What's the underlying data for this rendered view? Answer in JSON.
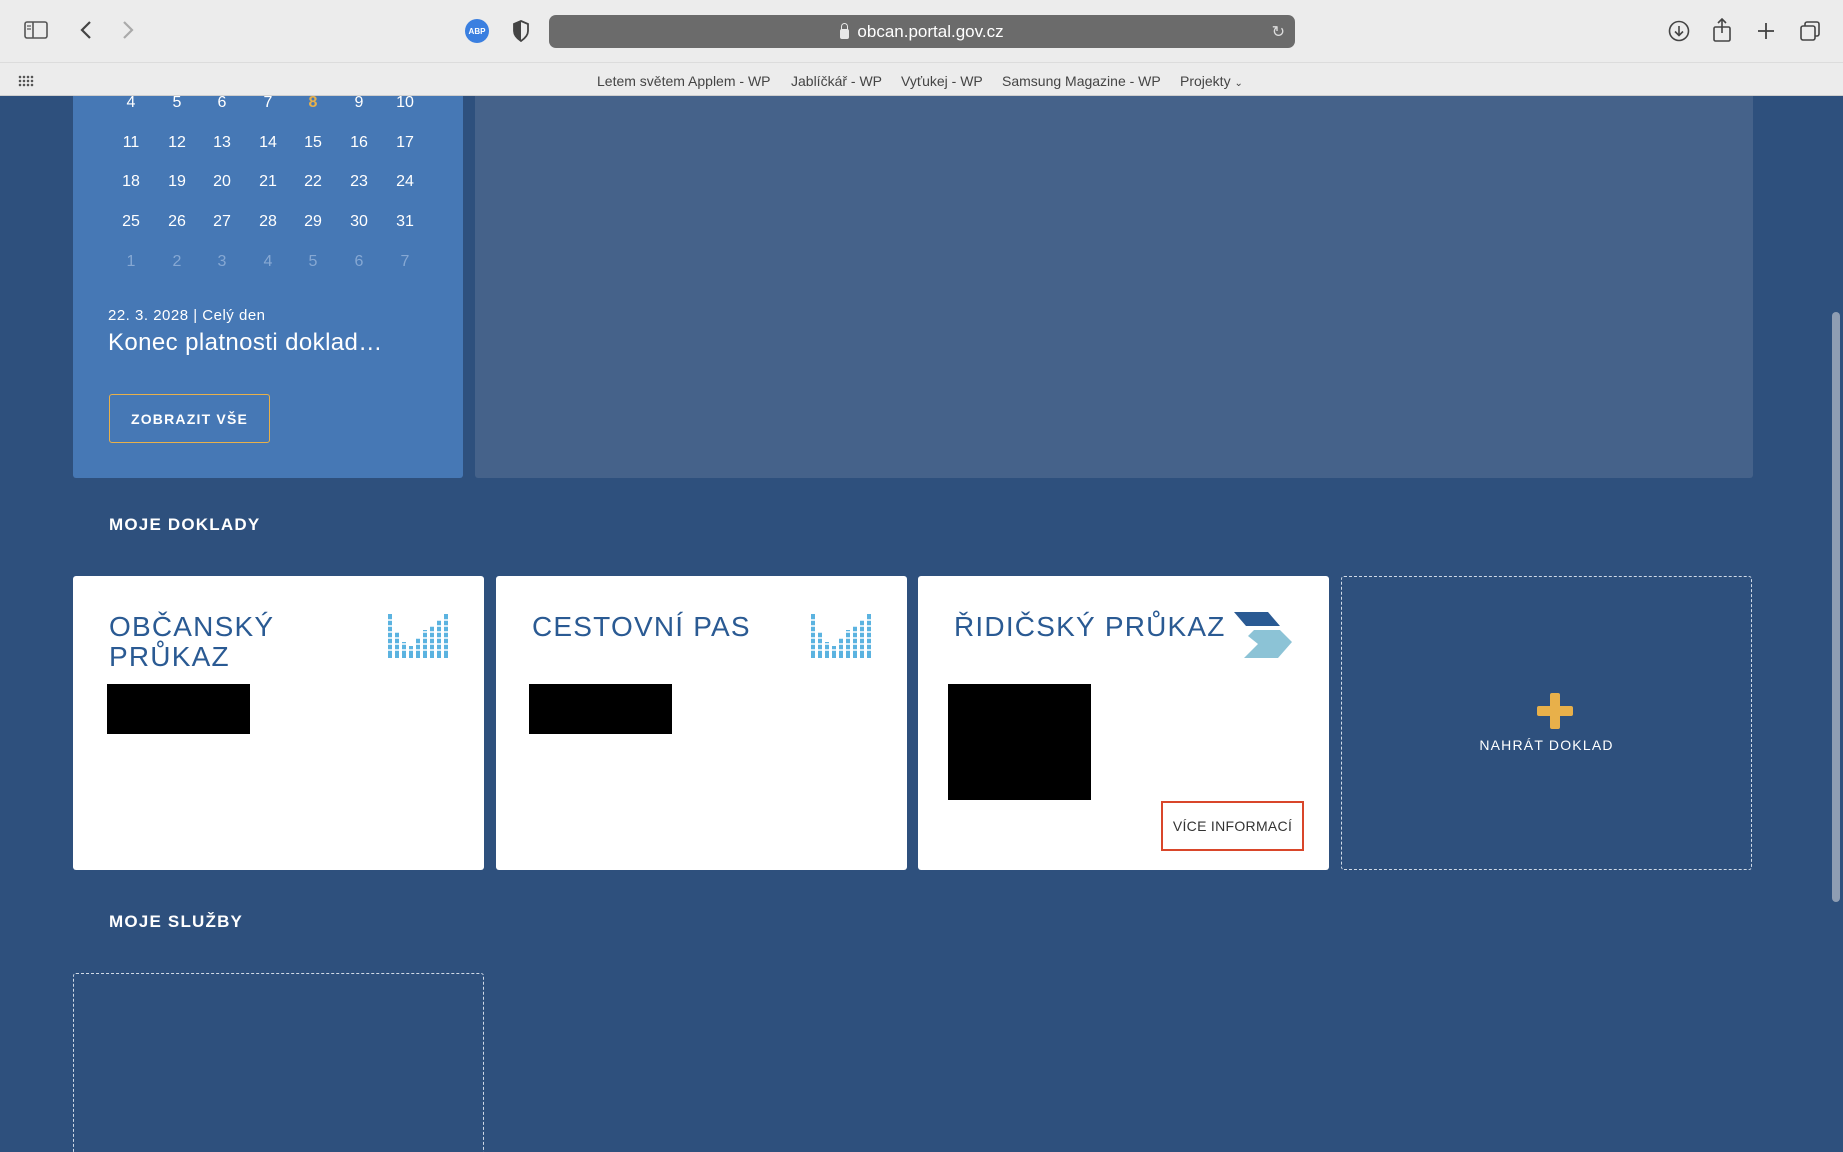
{
  "browser": {
    "url": "obcan.portal.gov.cz",
    "adblock_label": "ABP",
    "favorites": [
      {
        "label": "Letem světem Applem - WP"
      },
      {
        "label": "Jablíčkář - WP"
      },
      {
        "label": "Vyťukej - WP"
      },
      {
        "label": "Samsung Magazine - WP"
      },
      {
        "label": "Projekty"
      }
    ]
  },
  "calendar": {
    "weeks": [
      [
        "4",
        "5",
        "6",
        "7",
        "8",
        "9",
        "10"
      ],
      [
        "11",
        "12",
        "13",
        "14",
        "15",
        "16",
        "17"
      ],
      [
        "18",
        "19",
        "20",
        "21",
        "22",
        "23",
        "24"
      ],
      [
        "25",
        "26",
        "27",
        "28",
        "29",
        "30",
        "31"
      ],
      [
        "1",
        "2",
        "3",
        "4",
        "5",
        "6",
        "7"
      ]
    ],
    "today": "8",
    "event_date": "22. 3. 2028 | Celý den",
    "event_title": "Konec platnosti doklad…",
    "show_all_label": "ZOBRAZIT VŠE"
  },
  "documents": {
    "section_title": "MOJE DOKLADY",
    "cards": [
      {
        "title": "OBČANSKÝ PRŮKAZ"
      },
      {
        "title": "CESTOVNÍ PAS"
      },
      {
        "title": "ŘIDIČSKÝ PRŮKAZ",
        "more_label": "VÍCE INFORMACÍ"
      }
    ],
    "upload_label": "NAHRÁT DOKLAD"
  },
  "services": {
    "section_title": "MOJE SLUŽBY"
  },
  "colors": {
    "page_bg": "#2e507d",
    "calendar_bg": "#4678b5",
    "accent": "#e8b04a",
    "card_title": "#2a5a93",
    "highlight": "#d9462a"
  }
}
